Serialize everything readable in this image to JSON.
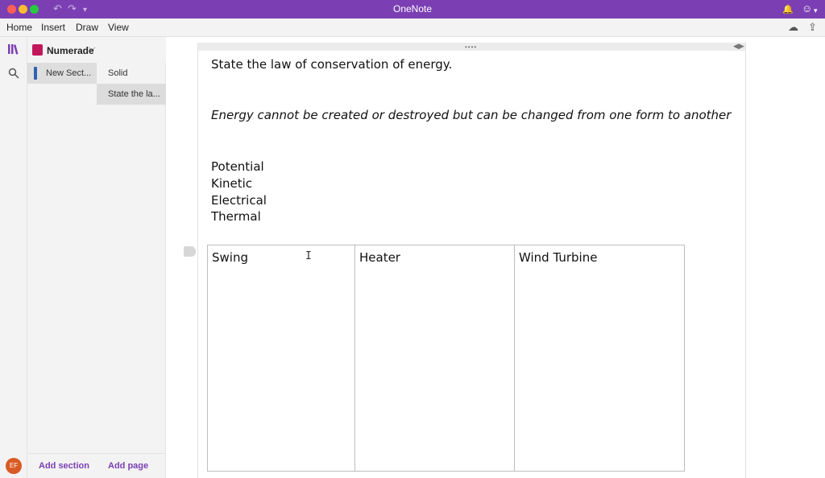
{
  "window": {
    "title": "OneNote",
    "icons": {
      "undo": "undo-icon",
      "redo": "redo-icon",
      "customize": "dropdown-arrow-icon",
      "notifications": "bell-icon",
      "feedback": "smiley-icon"
    }
  },
  "menu": {
    "items": [
      "Home",
      "Insert",
      "Draw",
      "View"
    ],
    "right_icons": [
      "sync-status-icon",
      "share-icon"
    ]
  },
  "nav": {
    "notebooks_icon": "notebooks-icon",
    "search_icon": "search-icon",
    "avatar_initials": "EF"
  },
  "notebook": {
    "name": "Numerade",
    "chevron": "chevron-down-icon"
  },
  "sections": {
    "items": [
      {
        "label": "New Sect...",
        "color": "#2e63b0"
      }
    ],
    "add_label": "Add section"
  },
  "pages": {
    "items": [
      {
        "label": "Solid"
      },
      {
        "label": "State the la..."
      }
    ],
    "add_label": "Add page"
  },
  "note": {
    "question": "State the law of conservation of energy.",
    "answer": "Energy cannot be created or destroyed but can be changed from one form to another",
    "energy_types": [
      "Potential",
      "Kinetic",
      "Electrical",
      "Thermal"
    ],
    "table_headers": [
      "Swing",
      "Heater",
      "Wind Turbine"
    ]
  },
  "colors": {
    "accent": "#7b3fb3",
    "section_tab": "#2e63b0",
    "notebook_icon": "#c2185b",
    "avatar": "#d85a24"
  }
}
